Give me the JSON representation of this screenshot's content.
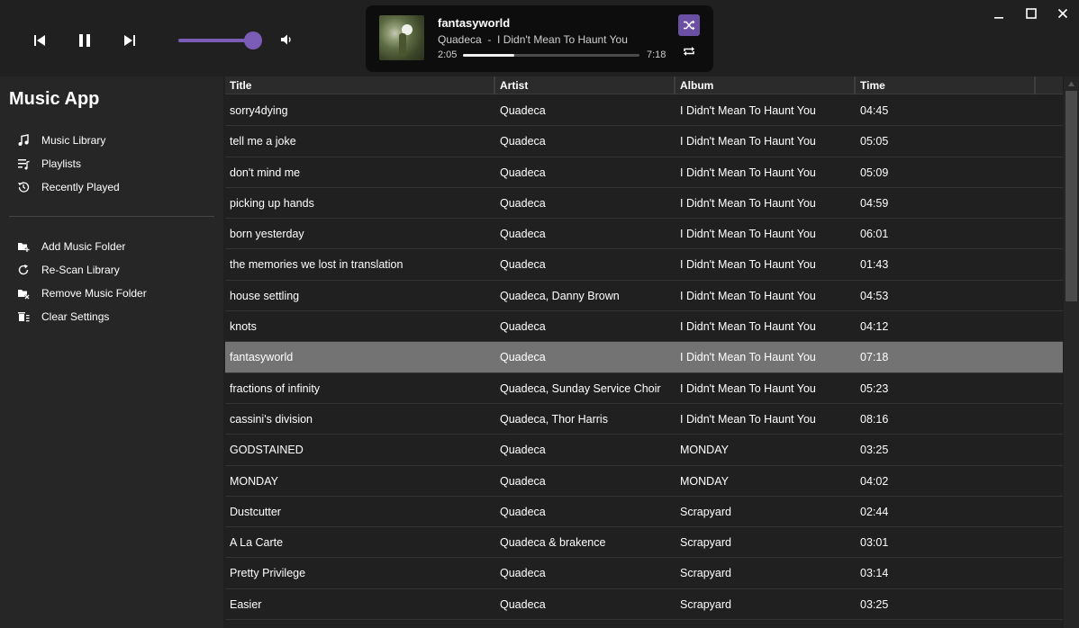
{
  "app": {
    "title": "Music App"
  },
  "player": {
    "controls": {
      "prev_icon": "skip-previous-icon",
      "pause_icon": "pause-icon",
      "next_icon": "skip-next-icon",
      "volume_icon": "volume-icon"
    },
    "volume_level": 0.9,
    "now_playing": {
      "title": "fantasyworld",
      "artist": "Quadeca",
      "separator": "  -  ",
      "album": "I Didn't Mean To Haunt You",
      "elapsed": "2:05",
      "total": "7:18",
      "progress": 0.29,
      "shuffle_icon": "shuffle-icon",
      "repeat_icon": "repeat-icon"
    }
  },
  "window_controls": [
    "minimize-icon",
    "maximize-icon",
    "close-icon"
  ],
  "sidebar": {
    "nav": [
      {
        "label": "Music Library",
        "icon": "music-note-icon"
      },
      {
        "label": "Playlists",
        "icon": "playlist-icon"
      },
      {
        "label": "Recently Played",
        "icon": "history-icon"
      }
    ],
    "actions": [
      {
        "label": "Add Music Folder",
        "icon": "folder-add-icon"
      },
      {
        "label": "Re-Scan Library",
        "icon": "refresh-icon"
      },
      {
        "label": "Remove Music Folder",
        "icon": "folder-remove-icon"
      },
      {
        "label": "Clear Settings",
        "icon": "delete-icon"
      }
    ]
  },
  "table": {
    "columns": [
      "Title",
      "Artist",
      "Album",
      "Time"
    ],
    "selected_index": 8,
    "rows": [
      {
        "title": "sorry4dying",
        "artist": "Quadeca",
        "album": "I Didn't Mean To Haunt You",
        "time": "04:45"
      },
      {
        "title": "tell me a joke",
        "artist": "Quadeca",
        "album": "I Didn't Mean To Haunt You",
        "time": "05:05"
      },
      {
        "title": "don't mind me",
        "artist": "Quadeca",
        "album": "I Didn't Mean To Haunt You",
        "time": "05:09"
      },
      {
        "title": "picking up hands",
        "artist": "Quadeca",
        "album": "I Didn't Mean To Haunt You",
        "time": "04:59"
      },
      {
        "title": "born yesterday",
        "artist": "Quadeca",
        "album": "I Didn't Mean To Haunt You",
        "time": "06:01"
      },
      {
        "title": "the memories we lost in translation",
        "artist": "Quadeca",
        "album": "I Didn't Mean To Haunt You",
        "time": "01:43"
      },
      {
        "title": "house settling",
        "artist": "Quadeca, Danny Brown",
        "album": "I Didn't Mean To Haunt You",
        "time": "04:53"
      },
      {
        "title": "knots",
        "artist": "Quadeca",
        "album": "I Didn't Mean To Haunt You",
        "time": "04:12"
      },
      {
        "title": "fantasyworld",
        "artist": "Quadeca",
        "album": "I Didn't Mean To Haunt You",
        "time": "07:18"
      },
      {
        "title": "fractions of infinity",
        "artist": "Quadeca, Sunday Service Choir",
        "album": "I Didn't Mean To Haunt You",
        "time": "05:23"
      },
      {
        "title": "cassini's division",
        "artist": "Quadeca, Thor Harris",
        "album": "I Didn't Mean To Haunt You",
        "time": "08:16"
      },
      {
        "title": "GODSTAINED",
        "artist": "Quadeca",
        "album": "MONDAY",
        "time": "03:25"
      },
      {
        "title": "MONDAY",
        "artist": "Quadeca",
        "album": "MONDAY",
        "time": "04:02"
      },
      {
        "title": "Dustcutter",
        "artist": "Quadeca",
        "album": "Scrapyard",
        "time": "02:44"
      },
      {
        "title": "A La Carte",
        "artist": "Quadeca & brakence",
        "album": "Scrapyard",
        "time": "03:01"
      },
      {
        "title": "Pretty Privilege",
        "artist": "Quadeca",
        "album": "Scrapyard",
        "time": "03:14"
      },
      {
        "title": "Easier",
        "artist": "Quadeca",
        "album": "Scrapyard",
        "time": "03:25"
      },
      {
        "title": "",
        "artist": "",
        "album": "",
        "time": ""
      }
    ]
  },
  "colors": {
    "accent": "#7b5cb6",
    "shuffle_bg": "#6b4fa3",
    "selected_row": "#737373",
    "background": "#202020",
    "sidebar": "#262626"
  }
}
